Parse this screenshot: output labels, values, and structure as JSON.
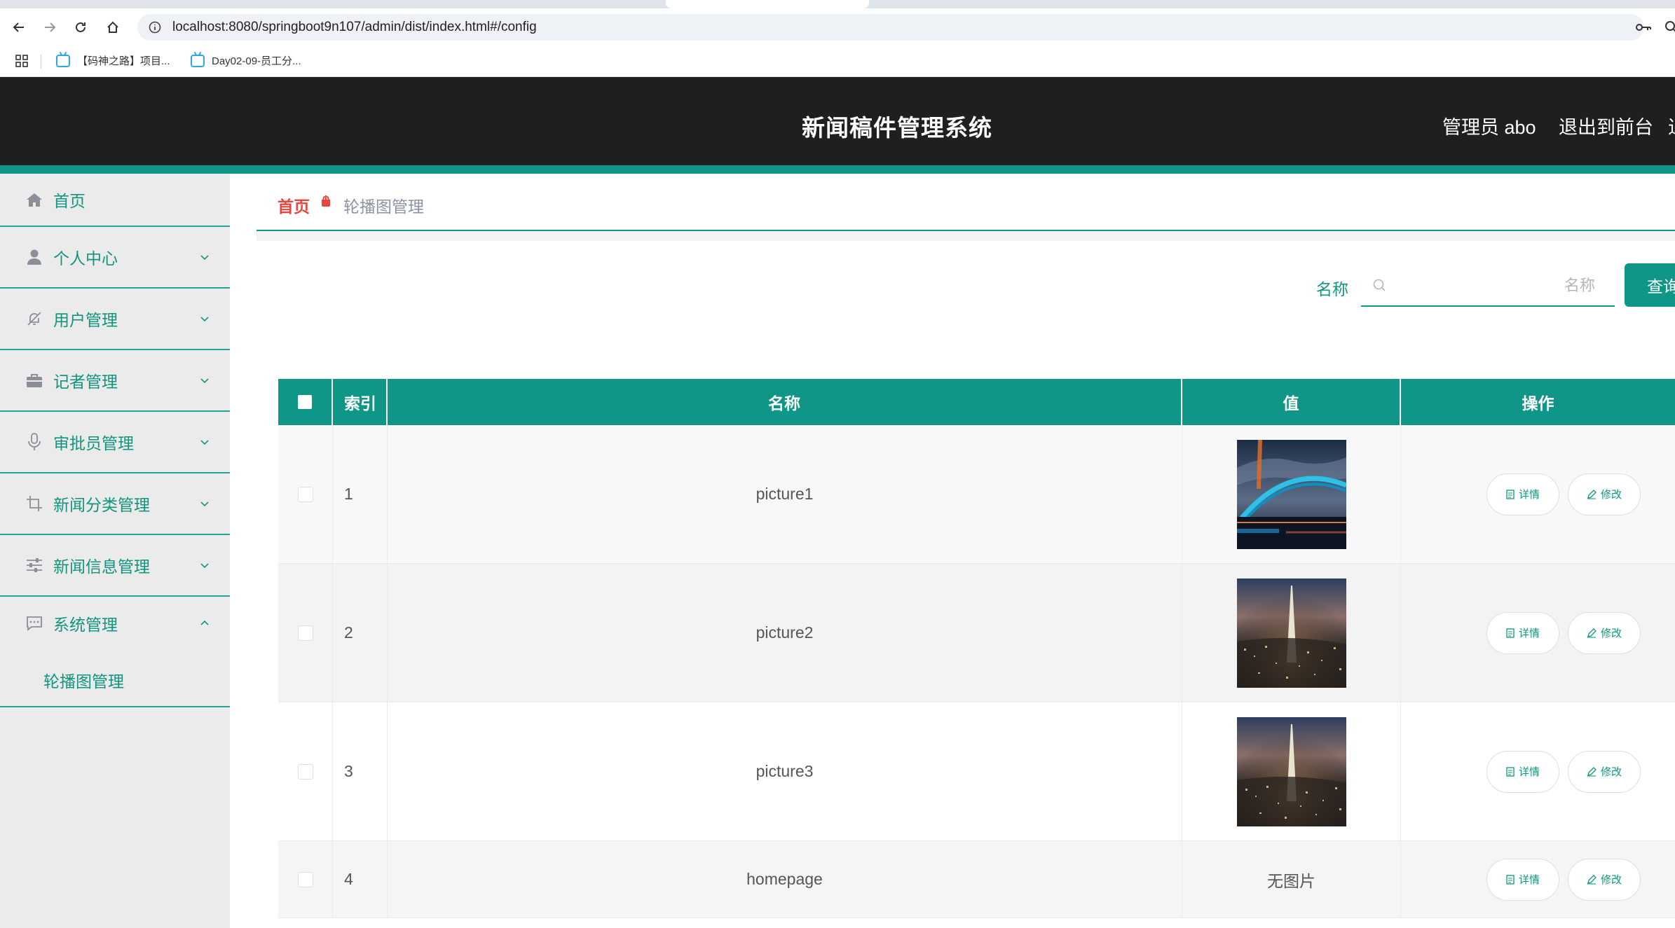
{
  "browser": {
    "url": "localhost:8080/springboot9n107/admin/dist/index.html#/config",
    "bookmarks": [
      {
        "label": "【码神之路】项目..."
      },
      {
        "label": "Day02-09-员工分..."
      }
    ]
  },
  "header": {
    "title": "新闻稿件管理系统",
    "user": "管理员 abo",
    "logout": "退出到前台",
    "more": "退"
  },
  "sidebar": {
    "items": [
      {
        "label": "首页",
        "icon": "home-icon"
      },
      {
        "label": "个人中心",
        "icon": "user-icon"
      },
      {
        "label": "用户管理",
        "icon": "bell-off-icon"
      },
      {
        "label": "记者管理",
        "icon": "briefcase-icon"
      },
      {
        "label": "审批员管理",
        "icon": "microphone-icon"
      },
      {
        "label": "新闻分类管理",
        "icon": "crop-icon"
      },
      {
        "label": "新闻信息管理",
        "icon": "sliders-icon"
      },
      {
        "label": "系统管理",
        "icon": "chat-icon"
      }
    ],
    "subitem": "轮播图管理"
  },
  "breadcrumb": {
    "home": "首页",
    "current": "轮播图管理"
  },
  "search": {
    "label": "名称",
    "placeholder": "名称",
    "button": "查询"
  },
  "table": {
    "headers": {
      "index": "索引",
      "name": "名称",
      "value": "值",
      "ops": "操作"
    },
    "rows": [
      {
        "index": "1",
        "name": "picture1",
        "value": "",
        "image": "bridge-night"
      },
      {
        "index": "2",
        "name": "picture2",
        "value": "",
        "image": "city-tower-night"
      },
      {
        "index": "3",
        "name": "picture3",
        "value": "",
        "image": "city-tower-night"
      },
      {
        "index": "4",
        "name": "homepage",
        "value": "无图片",
        "image": ""
      }
    ],
    "detail_label": "详情",
    "edit_label": "修改"
  },
  "colors": {
    "accent": "#0f9687",
    "header_bg": "#1f1f1f",
    "breadcrumb_home": "#e8463c"
  }
}
